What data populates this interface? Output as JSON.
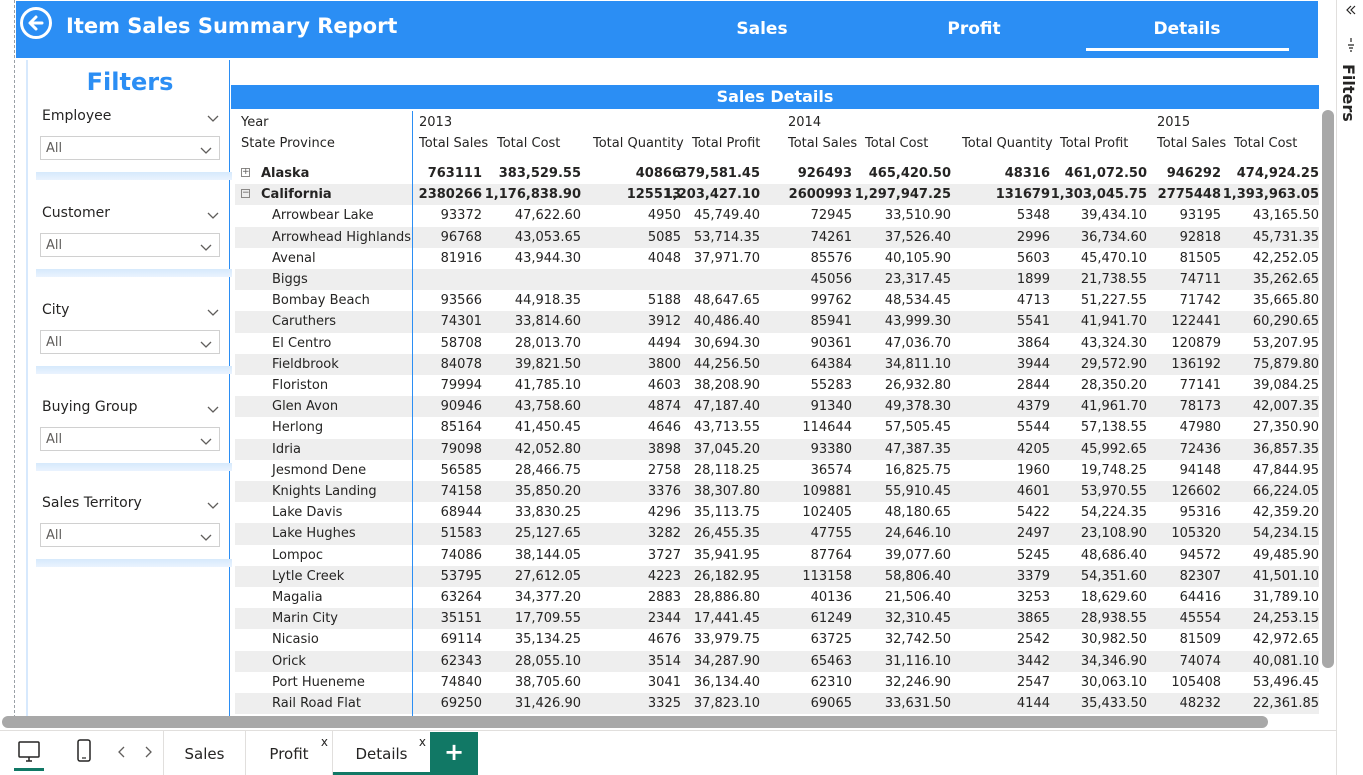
{
  "header": {
    "title": "Item Sales Summary Report",
    "nav": [
      "Sales",
      "Profit",
      "Details"
    ],
    "active_nav": "Details"
  },
  "filters": {
    "title": "Filters",
    "slicers": [
      {
        "label": "Employee",
        "value": "All"
      },
      {
        "label": "Customer",
        "value": "All"
      },
      {
        "label": "City",
        "value": "All"
      },
      {
        "label": "Buying Group",
        "value": "All"
      },
      {
        "label": "Sales Territory",
        "value": "All"
      }
    ]
  },
  "table": {
    "title": "Sales Details",
    "row_header_1": "Year",
    "row_header_2": "State Province",
    "years": [
      "2013",
      "2014",
      "2015"
    ],
    "measures_2013": [
      "Total Sales",
      "Total Cost",
      "Total Quantity",
      "Total Profit"
    ],
    "measures_2014": [
      "Total Sales",
      "Total Cost",
      "Total Quantity",
      "Total Profit"
    ],
    "measures_2015": [
      "Total Sales",
      "Total Cost"
    ],
    "rows": [
      {
        "name": "Alaska",
        "level": 0,
        "expander": "+",
        "v": [
          "763111",
          "383,529.55",
          "40866",
          "379,581.45",
          "926493",
          "465,420.50",
          "48316",
          "461,072.50",
          "946292",
          "474,924.25"
        ]
      },
      {
        "name": "California",
        "level": 0,
        "expander": "−",
        "v": [
          "2380266",
          "1,176,838.90",
          "125513",
          "1,203,427.10",
          "2600993",
          "1,297,947.25",
          "131679",
          "1,303,045.75",
          "2775448",
          "1,393,963.05"
        ]
      },
      {
        "name": "Arrowbear Lake",
        "level": 1,
        "v": [
          "93372",
          "47,622.60",
          "4950",
          "45,749.40",
          "72945",
          "33,510.90",
          "5348",
          "39,434.10",
          "93195",
          "43,165.50"
        ]
      },
      {
        "name": "Arrowhead Highlands",
        "level": 1,
        "v": [
          "96768",
          "43,053.65",
          "5085",
          "53,714.35",
          "74261",
          "37,526.40",
          "2996",
          "36,734.60",
          "92818",
          "45,731.35"
        ]
      },
      {
        "name": "Avenal",
        "level": 1,
        "v": [
          "81916",
          "43,944.30",
          "4048",
          "37,971.70",
          "85576",
          "40,105.90",
          "5603",
          "45,470.10",
          "81505",
          "42,252.05"
        ]
      },
      {
        "name": "Biggs",
        "level": 1,
        "v": [
          "",
          "",
          "",
          "",
          "45056",
          "23,317.45",
          "1899",
          "21,738.55",
          "74711",
          "35,262.65"
        ]
      },
      {
        "name": "Bombay Beach",
        "level": 1,
        "v": [
          "93566",
          "44,918.35",
          "5188",
          "48,647.65",
          "99762",
          "48,534.45",
          "4713",
          "51,227.55",
          "71742",
          "35,665.80"
        ]
      },
      {
        "name": "Caruthers",
        "level": 1,
        "v": [
          "74301",
          "33,814.60",
          "3912",
          "40,486.40",
          "85941",
          "43,999.30",
          "5541",
          "41,941.70",
          "122441",
          "60,290.65"
        ]
      },
      {
        "name": "El Centro",
        "level": 1,
        "v": [
          "58708",
          "28,013.70",
          "4494",
          "30,694.30",
          "90361",
          "47,036.70",
          "3864",
          "43,324.30",
          "120879",
          "53,207.95"
        ]
      },
      {
        "name": "Fieldbrook",
        "level": 1,
        "v": [
          "84078",
          "39,821.50",
          "3800",
          "44,256.50",
          "64384",
          "34,811.10",
          "3944",
          "29,572.90",
          "136192",
          "75,879.80"
        ]
      },
      {
        "name": "Floriston",
        "level": 1,
        "v": [
          "79994",
          "41,785.10",
          "4603",
          "38,208.90",
          "55283",
          "26,932.80",
          "2844",
          "28,350.20",
          "77141",
          "39,084.25"
        ]
      },
      {
        "name": "Glen Avon",
        "level": 1,
        "v": [
          "90946",
          "43,758.60",
          "4874",
          "47,187.40",
          "91340",
          "49,378.30",
          "4379",
          "41,961.70",
          "78173",
          "42,007.35"
        ]
      },
      {
        "name": "Herlong",
        "level": 1,
        "v": [
          "85164",
          "41,450.45",
          "4646",
          "43,713.55",
          "114644",
          "57,505.45",
          "5544",
          "57,138.55",
          "47980",
          "27,350.90"
        ]
      },
      {
        "name": "Idria",
        "level": 1,
        "v": [
          "79098",
          "42,052.80",
          "3898",
          "37,045.20",
          "93380",
          "47,387.35",
          "4205",
          "45,992.65",
          "72436",
          "36,857.35"
        ]
      },
      {
        "name": "Jesmond Dene",
        "level": 1,
        "v": [
          "56585",
          "28,466.75",
          "2758",
          "28,118.25",
          "36574",
          "16,825.75",
          "1960",
          "19,748.25",
          "94148",
          "47,844.95"
        ]
      },
      {
        "name": "Knights Landing",
        "level": 1,
        "v": [
          "74158",
          "35,850.20",
          "3376",
          "38,307.80",
          "109881",
          "55,910.45",
          "4601",
          "53,970.55",
          "126602",
          "66,224.05"
        ]
      },
      {
        "name": "Lake Davis",
        "level": 1,
        "v": [
          "68944",
          "33,830.25",
          "4296",
          "35,113.75",
          "102405",
          "48,180.65",
          "5422",
          "54,224.35",
          "95316",
          "42,359.20"
        ]
      },
      {
        "name": "Lake Hughes",
        "level": 1,
        "v": [
          "51583",
          "25,127.65",
          "3282",
          "26,455.35",
          "47755",
          "24,646.10",
          "2497",
          "23,108.90",
          "105320",
          "54,234.15"
        ]
      },
      {
        "name": "Lompoc",
        "level": 1,
        "v": [
          "74086",
          "38,144.05",
          "3727",
          "35,941.95",
          "87764",
          "39,077.60",
          "5245",
          "48,686.40",
          "94572",
          "49,485.90"
        ]
      },
      {
        "name": "Lytle Creek",
        "level": 1,
        "v": [
          "53795",
          "27,612.05",
          "4223",
          "26,182.95",
          "113158",
          "58,806.40",
          "3379",
          "54,351.60",
          "82307",
          "41,501.10"
        ]
      },
      {
        "name": "Magalia",
        "level": 1,
        "v": [
          "63264",
          "34,377.20",
          "2883",
          "28,886.80",
          "40136",
          "21,506.40",
          "3253",
          "18,629.60",
          "64416",
          "31,789.10"
        ]
      },
      {
        "name": "Marin City",
        "level": 1,
        "v": [
          "35151",
          "17,709.55",
          "2344",
          "17,441.45",
          "61249",
          "32,310.45",
          "3865",
          "28,938.55",
          "45554",
          "24,253.15"
        ]
      },
      {
        "name": "Nicasio",
        "level": 1,
        "v": [
          "69114",
          "35,134.25",
          "4676",
          "33,979.75",
          "63725",
          "32,742.50",
          "2542",
          "30,982.50",
          "81509",
          "42,972.65"
        ]
      },
      {
        "name": "Orick",
        "level": 1,
        "v": [
          "62343",
          "28,055.10",
          "3514",
          "34,287.90",
          "65463",
          "31,116.10",
          "3442",
          "34,346.90",
          "74074",
          "40,081.10"
        ]
      },
      {
        "name": "Port Hueneme",
        "level": 1,
        "v": [
          "74840",
          "38,705.60",
          "3041",
          "36,134.40",
          "62310",
          "32,246.90",
          "2547",
          "30,063.10",
          "105408",
          "53,496.45"
        ]
      },
      {
        "name": "Rail Road Flat",
        "level": 1,
        "v": [
          "69250",
          "31,426.90",
          "3325",
          "37,823.10",
          "69065",
          "33,631.50",
          "4144",
          "35,433.50",
          "48232",
          "22,361.85"
        ]
      }
    ]
  },
  "right_pane": {
    "label": "Filters"
  },
  "tabs": {
    "pages": [
      {
        "label": "Sales",
        "closable": false
      },
      {
        "label": "Profit",
        "closable": true,
        "close": "x"
      },
      {
        "label": "Details",
        "closable": true,
        "close": "x"
      }
    ],
    "add": "+"
  },
  "colors": {
    "accent": "#2b8ef4",
    "tab_accent": "#117865",
    "stripe": "#eeeeee"
  }
}
